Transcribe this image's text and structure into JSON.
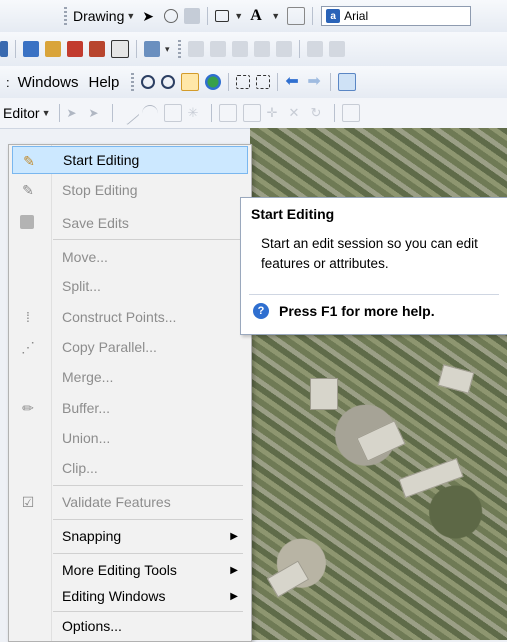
{
  "toolbar1": {
    "drawing_label": "Drawing",
    "font_name": "Arial",
    "text_tool_glyph": "A"
  },
  "menubar": {
    "items": [
      "Windows",
      "Help"
    ],
    "leading_fragment": ":"
  },
  "editor_toolbar": {
    "editor_label": "Editor"
  },
  "editor_menu": {
    "items": [
      {
        "label": "Start Editing",
        "enabled": true,
        "selected": true,
        "icon": "pencil-icon"
      },
      {
        "label": "Stop Editing",
        "enabled": false,
        "icon": "pencil-stop-icon"
      },
      {
        "label": "Save Edits",
        "enabled": false,
        "icon": "save-icon"
      },
      {
        "label": "Move...",
        "enabled": false
      },
      {
        "label": "Split...",
        "enabled": false
      },
      {
        "label": "Construct Points...",
        "enabled": false,
        "icon": "construct-points-icon"
      },
      {
        "label": "Copy Parallel...",
        "enabled": false,
        "icon": "copy-parallel-icon"
      },
      {
        "label": "Merge...",
        "enabled": false
      },
      {
        "label": "Buffer...",
        "enabled": false,
        "icon": "buffer-icon"
      },
      {
        "label": "Union...",
        "enabled": false
      },
      {
        "label": "Clip...",
        "enabled": false
      },
      {
        "label": "Validate Features",
        "enabled": false,
        "icon": "validate-icon"
      },
      {
        "label": "Snapping",
        "enabled": true,
        "submenu": true
      },
      {
        "label": "More Editing Tools",
        "enabled": true,
        "submenu": true
      },
      {
        "label": "Editing Windows",
        "enabled": true,
        "submenu": true
      },
      {
        "label": "Options...",
        "enabled": true
      }
    ]
  },
  "tooltip": {
    "title": "Start Editing",
    "body": "Start an edit session so you can edit features or attributes.",
    "help": "Press F1 for more help."
  },
  "colors": {
    "selection_bg": "#cce8ff",
    "selection_border": "#7ab7ef",
    "help_icon": "#2f6fd0"
  }
}
